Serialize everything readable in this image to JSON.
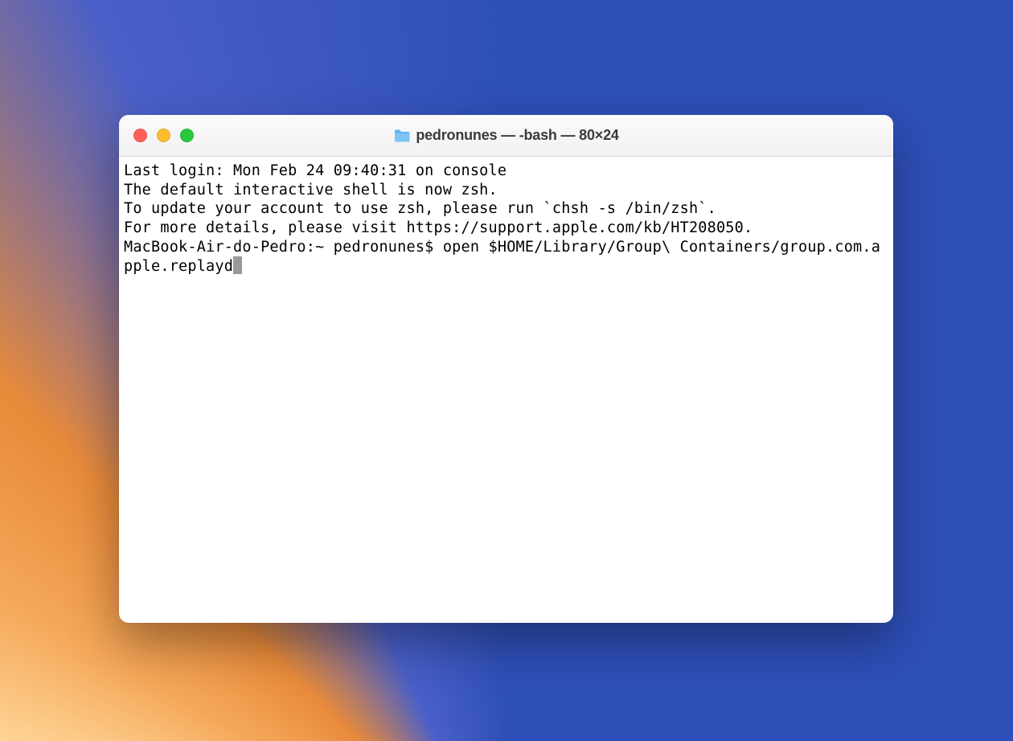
{
  "window": {
    "title": "pedronunes — -bash — 80×24"
  },
  "terminal": {
    "lines": [
      "Last login: Mon Feb 24 09:40:31 on console",
      "",
      "The default interactive shell is now zsh.",
      "To update your account to use zsh, please run `chsh -s /bin/zsh`.",
      "For more details, please visit https://support.apple.com/kb/HT208050."
    ],
    "prompt": "MacBook-Air-do-Pedro:~ pedronunes$ ",
    "command": "open $HOME/Library/Group\\ Containers/group.com.apple.replayd"
  }
}
